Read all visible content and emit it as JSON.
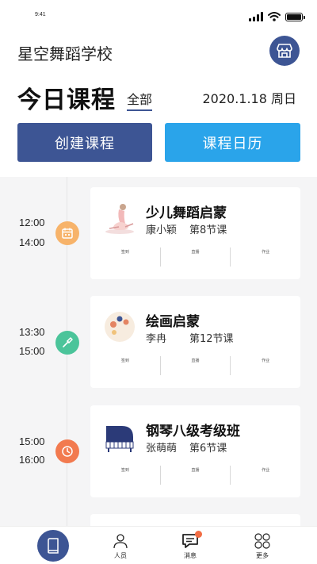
{
  "status_bar": {
    "time": "9:41"
  },
  "header": {
    "school_name": "星空舞蹈学校",
    "store_icon": "store-icon"
  },
  "title_row": {
    "title": "今日课程",
    "filter": "全部",
    "date": "2020.1.18 周日"
  },
  "actions": {
    "create": "创建课程",
    "calendar": "课程日历"
  },
  "courses": [
    {
      "start": "12:00",
      "end": "14:00",
      "icon": "calendar-icon",
      "dot_color": "#f7b36a",
      "title": "少儿舞蹈启蒙",
      "teacher": "康小颖",
      "lesson": "第8节课",
      "buttons": [
        "签到",
        "直播",
        "作业"
      ]
    },
    {
      "start": "13:30",
      "end": "15:00",
      "icon": "brush-icon",
      "dot_color": "#4bc49a",
      "title": "绘画启蒙",
      "teacher": "李冉",
      "lesson": "第12节课",
      "buttons": [
        "签到",
        "直播",
        "作业"
      ]
    },
    {
      "start": "15:00",
      "end": "16:00",
      "icon": "clock-icon",
      "dot_color": "#f27a4f",
      "title": "钢琴八级考级班",
      "teacher": "张萌萌",
      "lesson": "第6节课",
      "buttons": [
        "签到",
        "直播",
        "作业"
      ]
    }
  ],
  "tab_bar": {
    "home_icon": "book-icon",
    "people": "人员",
    "messages": "消息",
    "more": "更多"
  },
  "colors": {
    "primary": "#3d5594",
    "accent": "#2aa4ea",
    "badge": "#f26d44"
  }
}
